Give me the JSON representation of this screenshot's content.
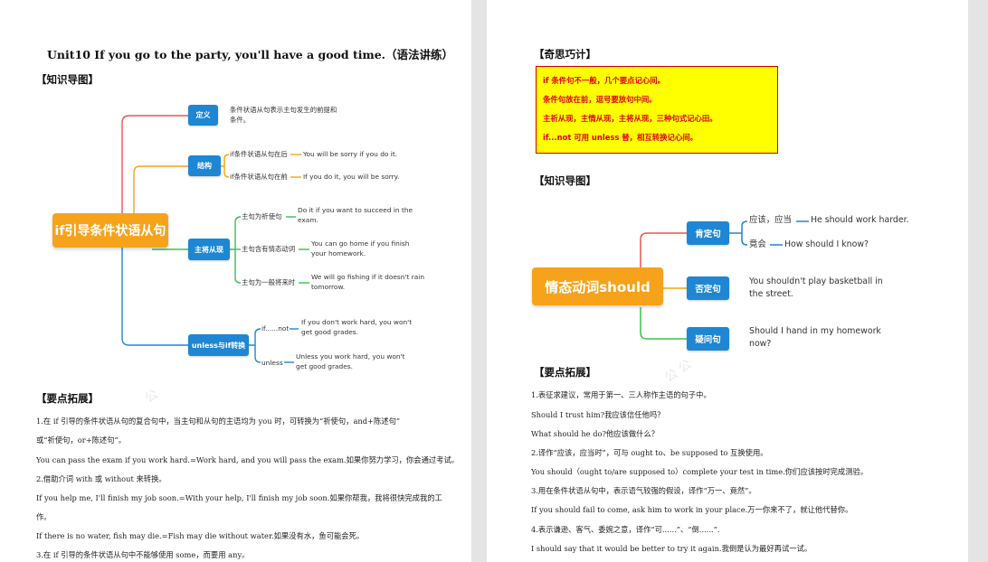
{
  "left": {
    "title": "Unit10 If you go to the party, you'll have a good time.（语法讲练）",
    "section_knowledge_map": "【知识导图】",
    "mindmap": {
      "main": "if引导条件状语从句",
      "definition": {
        "label": "定义",
        "text1": "条件状语从句表示主句发生的前提和",
        "text2": "条件。"
      },
      "structure": {
        "label": "结构",
        "item1_label": "if条件状语从句在后",
        "item1_example": "You will be sorry if you do it.",
        "item2_label": "if条件状语从句在前",
        "item2_example": "If you do it, you will be sorry."
      },
      "main_clause": {
        "label": "主将从现",
        "item1_label": "主句为祈使句",
        "item1_ex1": "Do it if you want to succeed in the",
        "item1_ex2": "exam.",
        "item2_label": "主句含有情态动词",
        "item2_ex1": "You can go home if you finish",
        "item2_ex2": "your homework.",
        "item3_label": "主句为一般将来时",
        "item3_ex1": "We will go fishing if it doesn't rain",
        "item3_ex2": "tomorrow."
      },
      "unless": {
        "label": "unless与if转换",
        "item1_label": "if......not",
        "item1_ex1": "If you don't work hard, you won't",
        "item1_ex2": "get good grades.",
        "item2_label": "unless",
        "item2_ex1": "Unless you work hard, you won't",
        "item2_ex2": "get good grades."
      }
    },
    "section_points": "【要点拓展】",
    "points": [
      "1.在 if 引导的条件状语从句的复合句中，当主句和从句的主语均为 you 时，可转换为“祈使句，and+陈述句”",
      "或“祈使句，or+陈述句”。",
      "You can pass the exam if you work hard.=Work hard, and you will pass the exam.如果你努力学习，你会通过考试。",
      "2.借助介词 with 或 without 来转换。",
      "If you help me, I'll finish my job soon.=With your help, I'll finish my job soon.如果你帮我，我将很快完成我的工",
      "作。",
      "If there is no water, fish may die.=Fish may die without water.如果没有水，鱼可能会死。",
      "3.在 if 引导的条件状语从句中不能够使用 some，而要用 any。"
    ]
  },
  "right": {
    "section_tips": "【奇思巧计】",
    "tips": [
      "if 条件句不一般，几个要点记心间。",
      "条件句放在前，逗号要放句中间。",
      "主祈从现，主情从现，主将从现，三种句式记心田。",
      "if...not 可用 unless 替，相互转换记心间。"
    ],
    "section_knowledge_map": "【知识导图】",
    "mindmap": {
      "main": "情态动词should",
      "affirmative": {
        "label": "肯定句",
        "item1_label": "应该，应当",
        "item1_example": "He should work harder.",
        "item2_label": "竟会",
        "item2_example": "How should I know?"
      },
      "negative": {
        "label": "否定句",
        "ex1": "You shouldn't play basketball in",
        "ex2": "the street."
      },
      "question": {
        "label": "疑问句",
        "ex1": "Should I hand in my homework",
        "ex2": "now?"
      }
    },
    "section_points": "【要点拓展】",
    "points": [
      "1.表征求建议，常用于第一、三人称作主语的句子中。",
      "Should I trust him?我应该信任他吗？",
      "What should he do?他应该做什么？",
      "2.译作“应该，应当时”，可与 ought to、be supposed to 互换使用。",
      "You should（ought to/are supposed to）complete your test in time.你们应该按时完成测验。",
      "3.用在条件状语从句中，表示语气较强的假设，译作“万一、竟然”。",
      "If you should fail to come, ask him to work in your place.万一你来不了，就让他代替你。",
      "4.表示谦逊、客气、委婉之意，译作“可......”、“倒......”.",
      "I should say that it would be better to try it again.我倒是认为最好再试一试。"
    ]
  },
  "colors": {
    "main_node": "#f7a21b",
    "sub_node": "#1e86d2",
    "branch_red": "#e8574e",
    "branch_orange": "#f7a21b",
    "branch_green": "#3fbf4f",
    "branch_blue": "#1e86d2",
    "tips_bg": "#ffff00",
    "tips_text": "#e0001a"
  }
}
